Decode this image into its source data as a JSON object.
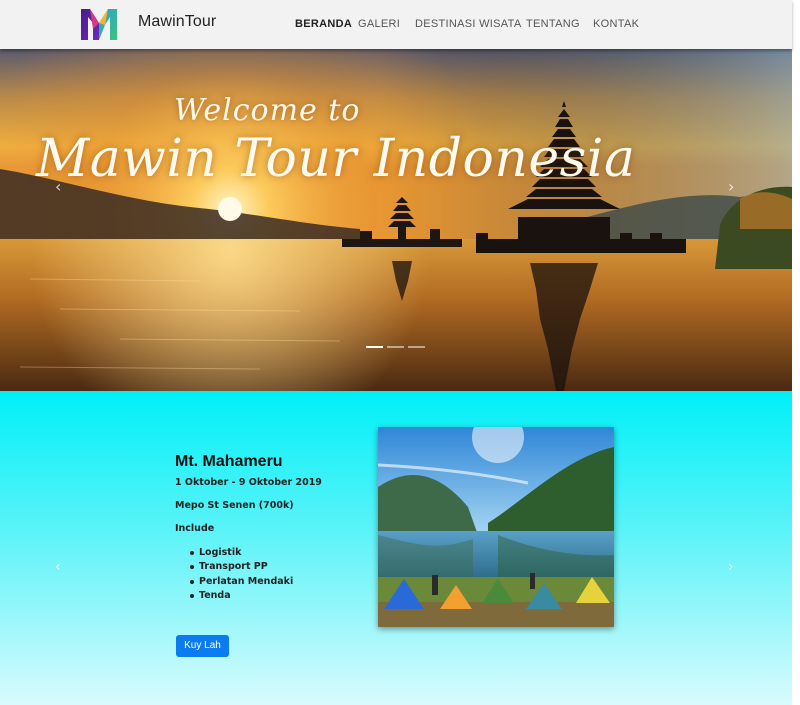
{
  "brand": {
    "name": "MawinTour",
    "logo_icon": "m-letter-logo"
  },
  "nav": {
    "items": [
      {
        "label": "BERANDA",
        "active": true
      },
      {
        "label": "GALERI",
        "active": false
      },
      {
        "label": "DESTINASI WISATA",
        "active": false
      },
      {
        "label": "TENTANG",
        "active": false
      },
      {
        "label": "KONTAK",
        "active": false
      }
    ]
  },
  "hero": {
    "welcome": "Welcome to",
    "title": "Mawin Tour Indonesia",
    "prev_icon": "chevron-left-icon",
    "next_icon": "chevron-right-icon",
    "slides": 3,
    "active_slide": 0
  },
  "tour": {
    "title": "Mt. Mahameru",
    "dates": "1 Oktober - 9 Oktober 2019",
    "meeting_point": "Mepo St Senen (700k)",
    "include_label": "Include",
    "include_items": [
      "Logistik",
      "Transport PP",
      "Perlatan Mendaki",
      "Tenda"
    ],
    "cta_label": "Kuy Lah",
    "prev_icon": "chevron-left-icon",
    "next_icon": "chevron-right-icon"
  },
  "colors": {
    "accent": "#0a7cf0",
    "section_bg_top": "#00f0f8",
    "navbar_bg": "#f2f2f2"
  }
}
